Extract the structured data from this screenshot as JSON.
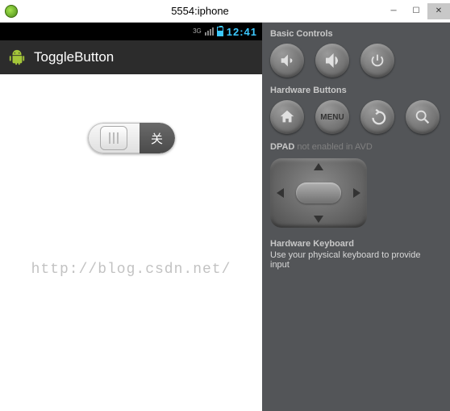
{
  "window": {
    "title": "5554:iphone"
  },
  "status": {
    "net": "3G",
    "time": "12:41"
  },
  "appbar": {
    "title": "ToggleButton"
  },
  "toggle": {
    "off_label": "关"
  },
  "watermark": "http://blog.csdn.net/",
  "controls": {
    "basic": {
      "header": "Basic Controls"
    },
    "hardware": {
      "header": "Hardware Buttons",
      "menu": "MENU"
    },
    "dpad": {
      "label": "DPAD",
      "note": " not enabled in AVD"
    },
    "keyboard": {
      "header": "Hardware Keyboard",
      "note": "Use your physical keyboard to provide input"
    }
  }
}
